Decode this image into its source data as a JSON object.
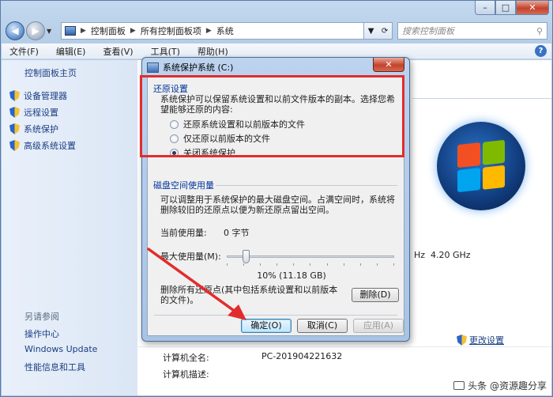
{
  "window": {
    "address": [
      "控制面板",
      "所有控制面板项",
      "系统"
    ],
    "search_placeholder": "搜索控制面板",
    "controls": {
      "minimize": "–",
      "maximize": "□",
      "close": "✕"
    }
  },
  "menu": [
    "文件(F)",
    "编辑(E)",
    "查看(V)",
    "工具(T)",
    "帮助(H)"
  ],
  "sidebar": {
    "home": "控制面板主页",
    "items": [
      "设备管理器",
      "远程设置",
      "系统保护",
      "高级系统设置"
    ],
    "see_also_title": "另请参阅",
    "see_also": [
      "操作中心",
      "Windows Update",
      "性能信息和工具"
    ]
  },
  "background_panel": {
    "cpu_partial": "Hz",
    "cpu_speed": "4.20 GHz",
    "change_settings": "更改设置",
    "computer_name_label": "计算机全名:",
    "computer_name_value": "PC-201904221632",
    "computer_desc_label": "计算机描述:"
  },
  "dialog": {
    "title": "系统保护系统 (C:)",
    "close": "✕",
    "restore": {
      "group_title": "还原设置",
      "description": "系统保护可以保留系统设置和以前文件版本的副本。选择您希望能够还原的内容:",
      "options": [
        "还原系统设置和以前版本的文件",
        "仅还原以前版本的文件",
        "关闭系统保护"
      ],
      "selected_index": 2
    },
    "disk": {
      "group_title": "磁盘空间使用量",
      "description": "可以调整用于系统保护的最大磁盘空间。占满空间时，系统将删除较旧的还原点以便为新还原点留出空间。",
      "current_label": "当前使用量:",
      "current_value": "0 字节",
      "max_label": "最大使用量(M):",
      "slider_fraction": 0.1,
      "slider_readout": "10% (11.18 GB)",
      "delete_text": "删除所有还原点(其中包括系统设置和以前版本的文件)。",
      "delete_button": "删除(D)"
    },
    "buttons": {
      "ok": "确定(O)",
      "cancel": "取消(C)",
      "apply": "应用(A)"
    }
  },
  "watermark": "头条 @资源趣分享",
  "colors": {
    "highlight_box": "#e22c2c",
    "link": "#1a3e82",
    "group_title": "#003399"
  }
}
